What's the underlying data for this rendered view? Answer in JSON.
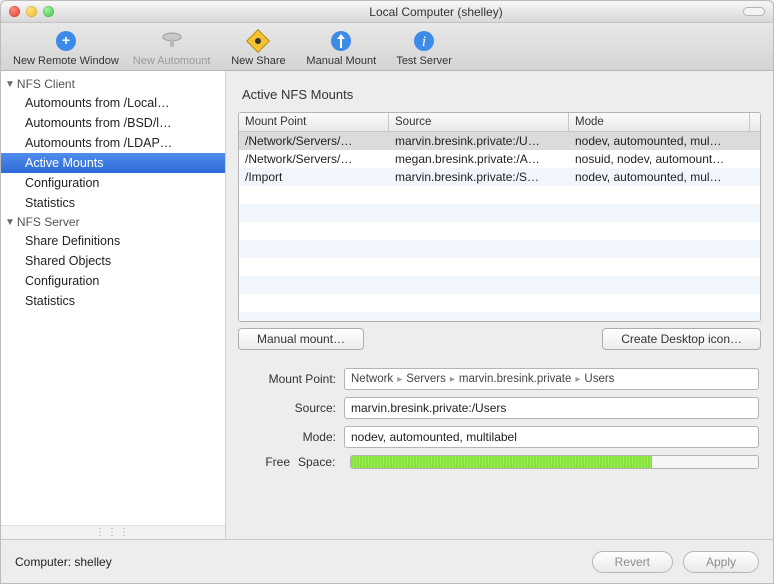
{
  "window": {
    "title": "Local Computer (shelley)"
  },
  "toolbar": {
    "items": [
      {
        "label": "New Remote Window",
        "icon": "globe-plus",
        "enabled": true
      },
      {
        "label": "New Automount",
        "icon": "disk",
        "enabled": false
      },
      {
        "label": "New Share",
        "icon": "diamond",
        "enabled": true
      },
      {
        "label": "Manual Mount",
        "icon": "arrows",
        "enabled": true
      },
      {
        "label": "Test Server",
        "icon": "info",
        "enabled": true
      }
    ]
  },
  "sidebar": {
    "groups": [
      {
        "label": "NFS Client",
        "items": [
          "Automounts from /Local…",
          "Automounts from /BSD/l…",
          "Automounts from /LDAP…",
          "Active Mounts",
          "Configuration",
          "Statistics"
        ],
        "selected_index": 3
      },
      {
        "label": "NFS Server",
        "items": [
          "Share Definitions",
          "Shared Objects",
          "Configuration",
          "Statistics"
        ],
        "selected_index": -1
      }
    ]
  },
  "main": {
    "section_title": "Active NFS Mounts",
    "table": {
      "columns": [
        "Mount Point",
        "Source",
        "Mode"
      ],
      "rows": [
        {
          "mount": "/Network/Servers/…",
          "source": "marvin.bresink.private:/U…",
          "mode": "nodev, automounted, mul…",
          "selected": true
        },
        {
          "mount": "/Network/Servers/…",
          "source": "megan.bresink.private:/A…",
          "mode": "nosuid, nodev, automount…",
          "selected": false
        },
        {
          "mount": "/Import",
          "source": "marvin.bresink.private:/S…",
          "mode": "nodev, automounted, mul…",
          "selected": false
        }
      ]
    },
    "buttons": {
      "manual_mount": "Manual mount…",
      "create_icon": "Create Desktop icon…"
    },
    "details": {
      "mount_point_label": "Mount Point:",
      "path": [
        "Network",
        "Servers",
        "marvin.bresink.private",
        "Users"
      ],
      "source_label": "Source:",
      "source_value": "marvin.bresink.private:/Users",
      "mode_label": "Mode:",
      "mode_value": "nodev, automounted, multilabel",
      "free_label": "Free",
      "space_label": "Space:",
      "free_percent": 74
    }
  },
  "footer": {
    "computer_label": "Computer: shelley",
    "revert": "Revert",
    "apply": "Apply"
  }
}
